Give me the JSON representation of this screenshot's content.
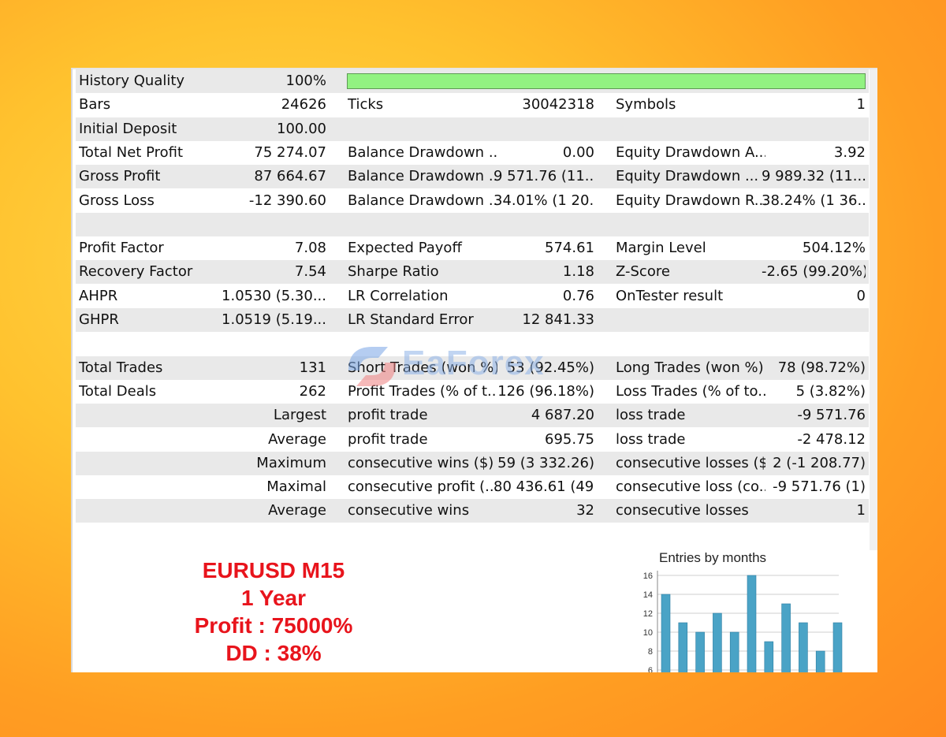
{
  "report": {
    "history_quality": {
      "label": "History Quality",
      "value": "100%",
      "quality": 1.0,
      "bar_color": "#92f281"
    },
    "rows": [
      {
        "c1": [
          "Bars",
          "24626"
        ],
        "c2": [
          "Ticks",
          "30042318"
        ],
        "c3": [
          "Symbols",
          "1"
        ]
      },
      {
        "c1": [
          "Initial Deposit",
          "100.00"
        ],
        "c2": [
          "",
          ""
        ],
        "c3": [
          "",
          ""
        ]
      },
      {
        "c1": [
          "Total Net Profit",
          "75 274.07"
        ],
        "c2": [
          "Balance Drawdown ...",
          "0.00"
        ],
        "c3": [
          "Equity Drawdown A...",
          "3.92"
        ]
      },
      {
        "c1": [
          "Gross Profit",
          "87 664.67"
        ],
        "c2": [
          "Balance Drawdown ...",
          "9 571.76 (11...."
        ],
        "c3": [
          "Equity Drawdown ...",
          "9 989.32 (11...."
        ]
      },
      {
        "c1": [
          "Gross Loss",
          "-12 390.60"
        ],
        "c2": [
          "Balance Drawdown ...",
          "34.01% (1 20..."
        ],
        "c3": [
          "Equity Drawdown R...",
          "38.24% (1 36..."
        ]
      },
      {
        "c1": [
          "",
          ""
        ],
        "c2": [
          "",
          ""
        ],
        "c3": [
          "",
          ""
        ]
      },
      {
        "c1": [
          "Profit Factor",
          "7.08"
        ],
        "c2": [
          "Expected Payoff",
          "574.61"
        ],
        "c3": [
          "Margin Level",
          "504.12%"
        ]
      },
      {
        "c1": [
          "Recovery Factor",
          "7.54"
        ],
        "c2": [
          "Sharpe Ratio",
          "1.18"
        ],
        "c3": [
          "Z-Score",
          "-2.65 (99.20%)"
        ]
      },
      {
        "c1": [
          "AHPR",
          "1.0530 (5.30..."
        ],
        "c2": [
          "LR Correlation",
          "0.76"
        ],
        "c3": [
          "OnTester result",
          "0"
        ]
      },
      {
        "c1": [
          "GHPR",
          "1.0519 (5.19..."
        ],
        "c2": [
          "LR Standard Error",
          "12 841.33"
        ],
        "c3": [
          "",
          ""
        ]
      },
      {
        "c1": [
          "",
          ""
        ],
        "c2": [
          "",
          ""
        ],
        "c3": [
          "",
          ""
        ]
      },
      {
        "c1": [
          "Total Trades",
          "131"
        ],
        "c2": [
          "Short Trades (won %)",
          "53 (92.45%)"
        ],
        "c3": [
          "Long Trades (won %)",
          "78 (98.72%)"
        ]
      },
      {
        "c1": [
          "Total Deals",
          "262"
        ],
        "c2": [
          "Profit Trades (% of t...",
          "126 (96.18%)"
        ],
        "c3": [
          "Loss Trades (% of to...",
          "5 (3.82%)"
        ]
      },
      {
        "c1": [
          "",
          "Largest"
        ],
        "c2": [
          "profit trade",
          "4 687.20"
        ],
        "c3": [
          "loss trade",
          "-9 571.76"
        ]
      },
      {
        "c1": [
          "",
          "Average"
        ],
        "c2": [
          "profit trade",
          "695.75"
        ],
        "c3": [
          "loss trade",
          "-2 478.12"
        ]
      },
      {
        "c1": [
          "",
          "Maximum"
        ],
        "c2": [
          "consecutive wins ($)",
          "59 (3 332.26)"
        ],
        "c3": [
          "consecutive losses ($)",
          "2 (-1 208.77)"
        ]
      },
      {
        "c1": [
          "",
          "Maximal"
        ],
        "c2": [
          "consecutive profit (...",
          "80 436.61 (49)"
        ],
        "c3": [
          "consecutive loss (co...",
          "-9 571.76 (1)"
        ]
      },
      {
        "c1": [
          "",
          "Average"
        ],
        "c2": [
          "consecutive wins",
          "32"
        ],
        "c3": [
          "consecutive losses",
          "1"
        ]
      },
      {
        "c1": [
          "",
          ""
        ],
        "c2": [
          "",
          ""
        ],
        "c3": [
          "",
          ""
        ]
      }
    ]
  },
  "promo": {
    "line1": "EURUSD M15",
    "line2": "1 Year",
    "line3": "Profit : 75000%",
    "line4": "DD : 38%",
    "color": "#e8141c"
  },
  "watermark": {
    "text": "EaForex"
  },
  "chart_data": {
    "type": "bar",
    "title": "Entries by months",
    "values": [
      14,
      11,
      10,
      12,
      10,
      16,
      9,
      13,
      11,
      8,
      11
    ],
    "yticks": [
      "16",
      "14",
      "12",
      "10",
      "8",
      "6"
    ],
    "ylim": [
      6,
      16
    ],
    "grid": true,
    "bar_color": "#4aa3c6"
  }
}
